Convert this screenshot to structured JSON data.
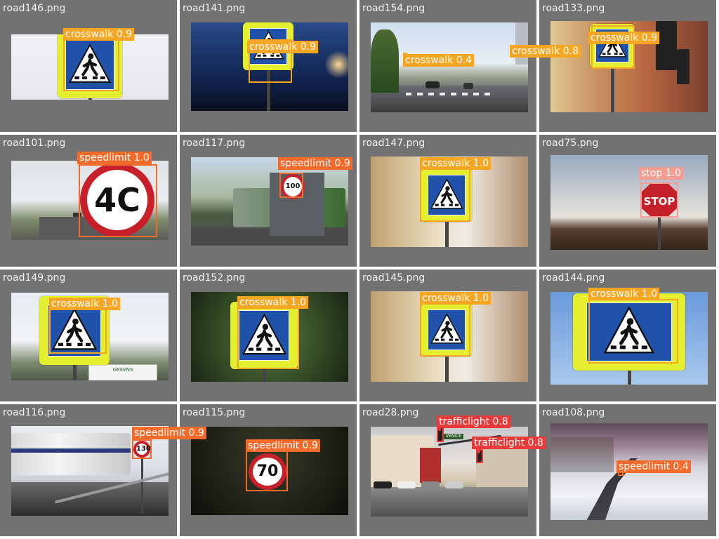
{
  "colors": {
    "crosswalk": "#f5a623",
    "speedlimit": "#f26b2a",
    "stop": "#f59d92",
    "trafficlight": "#e83a3a"
  },
  "cells": [
    {
      "filename": "road146.png",
      "detections": [
        {
          "label": "crosswalk",
          "score": "0.9",
          "cls": "crosswalk"
        }
      ]
    },
    {
      "filename": "road141.png",
      "detections": [
        {
          "label": "crosswalk",
          "score": "0.9",
          "cls": "crosswalk"
        }
      ]
    },
    {
      "filename": "road154.png",
      "detections": [
        {
          "label": "crosswalk",
          "score": "0.4",
          "cls": "crosswalk"
        },
        {
          "label": "crosswalk",
          "score": "0.8",
          "cls": "crosswalk"
        }
      ]
    },
    {
      "filename": "road133.png",
      "detections": [
        {
          "label": "crosswalk",
          "score": "0.9",
          "cls": "crosswalk"
        }
      ]
    },
    {
      "filename": "road101.png",
      "detections": [
        {
          "label": "speedlimit",
          "score": "1.0",
          "cls": "speedlimit"
        }
      ]
    },
    {
      "filename": "road117.png",
      "detections": [
        {
          "label": "speedlimit",
          "score": "0.9",
          "cls": "speedlimit"
        }
      ]
    },
    {
      "filename": "road147.png",
      "detections": [
        {
          "label": "crosswalk",
          "score": "1.0",
          "cls": "crosswalk"
        }
      ]
    },
    {
      "filename": "road75.png",
      "detections": [
        {
          "label": "stop",
          "score": "1.0",
          "cls": "stop"
        }
      ]
    },
    {
      "filename": "road149.png",
      "detections": [
        {
          "label": "crosswalk",
          "score": "1.0",
          "cls": "crosswalk"
        }
      ]
    },
    {
      "filename": "road152.png",
      "detections": [
        {
          "label": "crosswalk",
          "score": "1.0",
          "cls": "crosswalk"
        }
      ]
    },
    {
      "filename": "road145.png",
      "detections": [
        {
          "label": "crosswalk",
          "score": "1.0",
          "cls": "crosswalk"
        }
      ]
    },
    {
      "filename": "road144.png",
      "detections": [
        {
          "label": "crosswalk",
          "score": "1.0",
          "cls": "crosswalk"
        }
      ]
    },
    {
      "filename": "road116.png",
      "detections": [
        {
          "label": "speedlimit",
          "score": "0.9",
          "cls": "speedlimit"
        }
      ]
    },
    {
      "filename": "road115.png",
      "detections": [
        {
          "label": "speedlimit",
          "score": "0.9",
          "cls": "speedlimit"
        }
      ]
    },
    {
      "filename": "road28.png",
      "detections": [
        {
          "label": "trafficlight",
          "score": "0.8",
          "cls": "trafficlight"
        },
        {
          "label": "trafficlight",
          "score": "0.8",
          "cls": "trafficlight"
        }
      ]
    },
    {
      "filename": "road108.png",
      "detections": [
        {
          "label": "speedlimit",
          "score": "0.4",
          "cls": "speedlimit"
        }
      ]
    }
  ],
  "sign_text": {
    "speed_40": "4C",
    "speed_100": "100",
    "speed_130": "130",
    "speed_70": "70",
    "stop": "STOP",
    "store_sign": "GREENS",
    "street_sign": "VENICE"
  }
}
